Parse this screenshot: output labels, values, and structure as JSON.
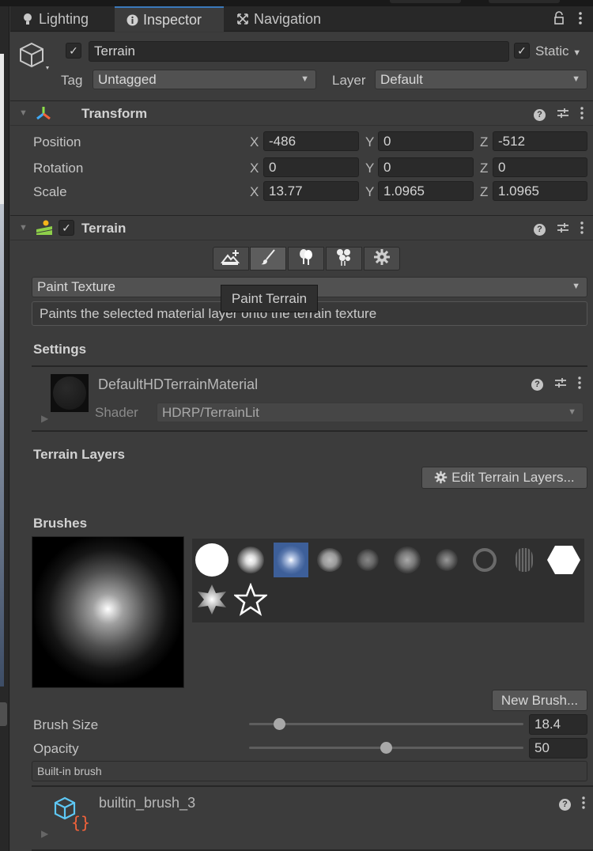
{
  "tabs": [
    {
      "label": "Lighting",
      "icon": "lightbulb-icon",
      "active": false
    },
    {
      "label": "Inspector",
      "icon": "info-icon",
      "active": true
    },
    {
      "label": "Navigation",
      "icon": "navigation-icon",
      "active": false
    }
  ],
  "header": {
    "object_name": "Terrain",
    "active": true,
    "static_label": "Static",
    "static_checked": true,
    "tag_label": "Tag",
    "tag_value": "Untagged",
    "layer_label": "Layer",
    "layer_value": "Default"
  },
  "transform": {
    "title": "Transform",
    "rows": [
      {
        "label": "Position",
        "x": "-486",
        "y": "0",
        "z": "-512"
      },
      {
        "label": "Rotation",
        "x": "0",
        "y": "0",
        "z": "0"
      },
      {
        "label": "Scale",
        "x": "13.77",
        "y": "1.0965",
        "z": "1.0965"
      }
    ],
    "axis": {
      "x": "X",
      "y": "Y",
      "z": "Z"
    }
  },
  "terrain": {
    "title": "Terrain",
    "enabled": true,
    "tools": [
      {
        "name": "raise-lower-terrain",
        "icon": "mountain-plus-icon",
        "selected": false
      },
      {
        "name": "paint-terrain",
        "icon": "paintbrush-icon",
        "selected": true
      },
      {
        "name": "paint-trees",
        "icon": "trees-icon",
        "selected": false
      },
      {
        "name": "paint-details",
        "icon": "flowers-icon",
        "selected": false
      },
      {
        "name": "terrain-settings",
        "icon": "gear-icon",
        "selected": false
      }
    ],
    "mode_value": "Paint Texture",
    "tooltip": "Paint Terrain",
    "description": "Paints the selected material layer onto the terrain texture",
    "settings_heading": "Settings",
    "material": {
      "name": "DefaultHDTerrainMaterial",
      "shader_label": "Shader",
      "shader_value": "HDRP/TerrainLit"
    },
    "terrain_layers_heading": "Terrain Layers",
    "edit_layers_button": "Edit Terrain Layers...",
    "brushes_heading": "Brushes",
    "brushes": [
      {
        "name": "hard-circle",
        "selected": false
      },
      {
        "name": "soft-circle",
        "selected": false
      },
      {
        "name": "gaussian",
        "selected": true
      },
      {
        "name": "cloud",
        "selected": false
      },
      {
        "name": "noise-1",
        "selected": false
      },
      {
        "name": "noise-2",
        "selected": false
      },
      {
        "name": "noise-3",
        "selected": false
      },
      {
        "name": "cells",
        "selected": false
      },
      {
        "name": "grass",
        "selected": false
      },
      {
        "name": "hexagon",
        "selected": false
      },
      {
        "name": "star-soft",
        "selected": false
      },
      {
        "name": "star-outline",
        "selected": false
      }
    ],
    "new_brush_button": "New Brush...",
    "brush_size_label": "Brush Size",
    "brush_size_value": "18.4",
    "brush_size_fraction": 0.11,
    "opacity_label": "Opacity",
    "opacity_value": "50",
    "opacity_fraction": 0.5,
    "brush_type": "Built-in brush",
    "brush_asset_name": "builtin_brush_3"
  }
}
